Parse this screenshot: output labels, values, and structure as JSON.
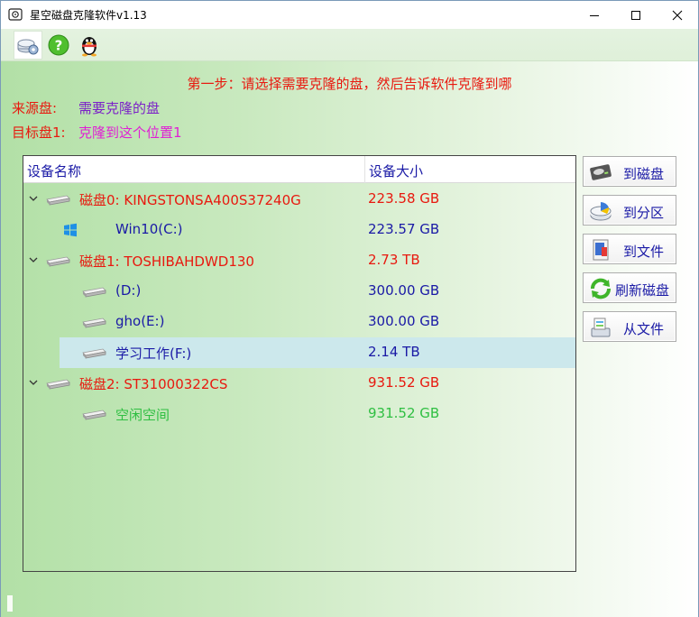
{
  "window": {
    "title": "星空磁盘克隆软件v1.13"
  },
  "toolbar": {
    "buttons": [
      {
        "icon": "settings-disk-icon"
      },
      {
        "icon": "help-icon"
      },
      {
        "icon": "qq-penguin-icon"
      }
    ]
  },
  "step": {
    "text": "第一步：请选择需要克隆的盘，然后告诉软件克隆到哪"
  },
  "source": {
    "label": "来源盘:",
    "value": "需要克隆的盘"
  },
  "target": {
    "label": "目标盘1:",
    "value": "克隆到这个位置1"
  },
  "tree": {
    "columns": [
      "设备名称",
      "设备大小"
    ],
    "rows": [
      {
        "name": "磁盘0: KINGSTONSA400S37240G",
        "size": "223.58 GB",
        "type": "disk",
        "color": "#e8190f"
      },
      {
        "name": "Win10(C:)",
        "size": "223.57 GB",
        "type": "windows-partition",
        "color": "#1a1aa6"
      },
      {
        "name": "磁盘1: TOSHIBAHDWD130",
        "size": "2.73 TB",
        "type": "disk",
        "color": "#e8190f"
      },
      {
        "name": "(D:)",
        "size": "300.00 GB",
        "type": "partition",
        "color": "#1a1aa6"
      },
      {
        "name": "gho(E:)",
        "size": "300.00 GB",
        "type": "partition",
        "color": "#1a1aa6"
      },
      {
        "name": "学习工作(F:)",
        "size": "2.14 TB",
        "type": "partition",
        "color": "#1a1aa6",
        "selected": true
      },
      {
        "name": "磁盘2: ST31000322CS",
        "size": "931.52 GB",
        "type": "disk",
        "color": "#e8190f"
      },
      {
        "name": "空闲空间",
        "size": "931.52 GB",
        "type": "free-space",
        "color": "#2fbf42"
      }
    ]
  },
  "actions": {
    "to_disk": "到磁盘",
    "to_partition": "到分区",
    "to_file": "到文件",
    "refresh": "刷新磁盘",
    "from_file": "从文件"
  }
}
